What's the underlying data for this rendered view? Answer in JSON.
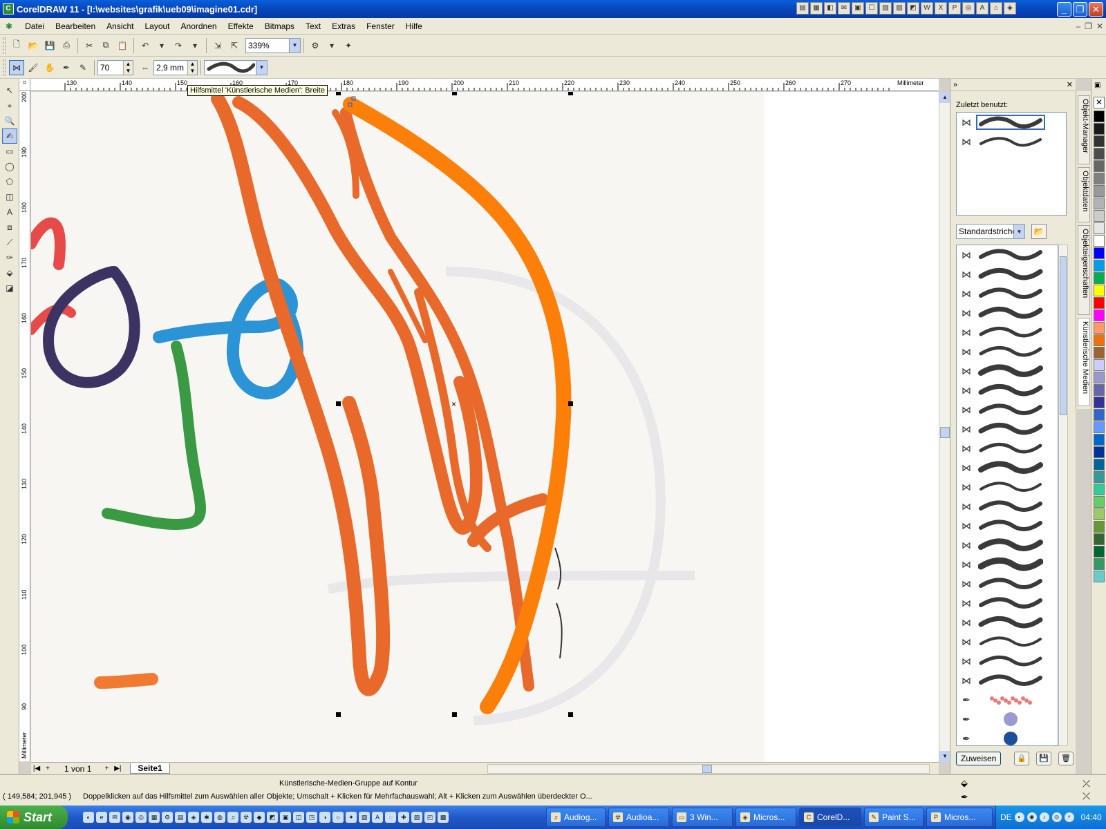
{
  "window": {
    "title": "CorelDRAW 11 - [I:\\websites\\grafik\\ueb09\\imagine01.cdr]",
    "controls": {
      "minimize": "_",
      "maximize": "❐",
      "close": "✕"
    }
  },
  "menu": {
    "items": [
      "Datei",
      "Bearbeiten",
      "Ansicht",
      "Layout",
      "Anordnen",
      "Effekte",
      "Bitmaps",
      "Text",
      "Extras",
      "Fenster",
      "Hilfe"
    ]
  },
  "toolbar1": {
    "zoom_value": "339%"
  },
  "toolbar2": {
    "angle_value": "70",
    "width_value": "2,9 mm"
  },
  "tooltip": {
    "text": "Hilfsmittel 'Künstlerische Medien': Breite"
  },
  "ruler": {
    "unit_label": "Millimeter",
    "h_ticks": [
      "130",
      "140",
      "150",
      "160",
      "170",
      "180",
      "190",
      "200",
      "210",
      "220",
      "230",
      "240",
      "250",
      "260",
      "270"
    ],
    "v_ticks": [
      "200",
      "190",
      "180",
      "170",
      "160",
      "150",
      "140",
      "130",
      "120",
      "110",
      "100",
      "90"
    ]
  },
  "pagebar": {
    "page_count": "1 von 1",
    "page_tab": "Seite1"
  },
  "docker": {
    "recent_label": "Zuletzt benutzt:",
    "category_value": "Standardstriche",
    "apply_button": "Zuweisen"
  },
  "docker_tabs": [
    "Objekt-Manager",
    "Objektdaten",
    "Objekteigenschaften",
    "Künstlerische Medien"
  ],
  "palette": {
    "colors": [
      "#000000",
      "#1a1a1a",
      "#333333",
      "#4d4d4d",
      "#666666",
      "#808080",
      "#999999",
      "#b3b3b3",
      "#cccccc",
      "#e6e6e6",
      "#ffffff",
      "#0000ff",
      "#00a0e8",
      "#00b050",
      "#ffff00",
      "#ff0000",
      "#ff00ff",
      "#ff9966",
      "#f07010",
      "#996633",
      "#ccccff",
      "#9999cc",
      "#6666aa",
      "#333399",
      "#3366cc",
      "#6699ff",
      "#0066cc",
      "#003399",
      "#006699",
      "#339999",
      "#33cc99",
      "#66cc66",
      "#99cc66",
      "#669933",
      "#336633",
      "#006633",
      "#339966",
      "#66cccc"
    ]
  },
  "statusbar": {
    "center_text": "Künstlerische-Medien-Gruppe auf Kontur",
    "coords": "( 149,584; 201,945 )",
    "hint": "Doppelklicken auf das Hilfsmittel zum Auswählen aller Objekte; Umschalt + Klicken für Mehrfachauswahl; Alt + Klicken zum Auswählen überdeckter O..."
  },
  "taskbar": {
    "start_label": "Start",
    "tasks": [
      "Audiog...",
      "Audioa...",
      "3 Win...",
      "Micros...",
      "CorelD...",
      "Paint S...",
      "Micros..."
    ],
    "language": "DE",
    "clock": "04:40"
  }
}
